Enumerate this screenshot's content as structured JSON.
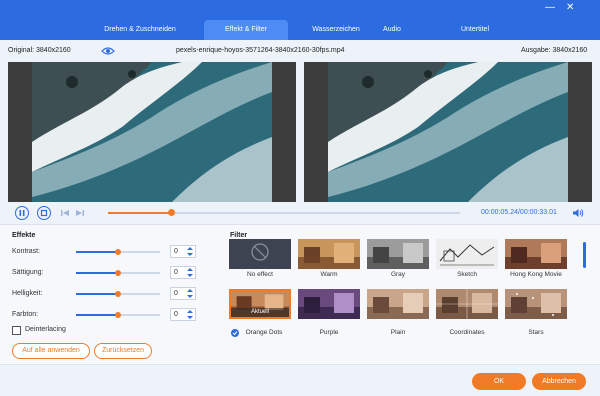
{
  "window": {
    "minimize_glyph": "—",
    "close_glyph": "✕"
  },
  "tabs": [
    {
      "label": "Drehen & Zuschneiden",
      "active": false
    },
    {
      "label": "Effekt & Filter",
      "active": true
    },
    {
      "label": "Wasserzeichen",
      "active": false
    },
    {
      "label": "Audio",
      "active": false
    },
    {
      "label": "Untertitel",
      "active": false
    }
  ],
  "infobar": {
    "original": "Original: 3840x2160",
    "filename": "pexels-enrique-hoyos-3571264-3840x2160-30fps.mp4",
    "output": "Ausgabe: 3840x2160"
  },
  "playback": {
    "progress": 0.18,
    "time": "00:00:05.24/00:00:33.01"
  },
  "effects": {
    "heading": "Effekte",
    "rows": [
      {
        "label": "Kontrast:",
        "value": "0",
        "level": 0.5
      },
      {
        "label": "Sättigung:",
        "value": "0",
        "level": 0.5
      },
      {
        "label": "Helligkeit:",
        "value": "0",
        "level": 0.5
      },
      {
        "label": "Farbton:",
        "value": "0",
        "level": 0.5
      }
    ],
    "deinterlacing": "Deinterlacing",
    "apply_all": "Auf alle anwenden",
    "reset": "Zurücksetzen"
  },
  "filters": {
    "heading": "Filter",
    "current_badge": "Aktuell",
    "items": [
      {
        "label": "No effect"
      },
      {
        "label": "Warm"
      },
      {
        "label": "Gray"
      },
      {
        "label": "Sketch"
      },
      {
        "label": "Hong Kong Movie"
      },
      {
        "label": "Orange Dots",
        "selected": true
      },
      {
        "label": "Purple"
      },
      {
        "label": "Plain"
      },
      {
        "label": "Coordinates"
      },
      {
        "label": "Stars"
      }
    ]
  },
  "footer": {
    "ok": "OK",
    "cancel": "Abbrechen"
  },
  "colors": {
    "brand_blue": "#2d6ce0",
    "accent_orange": "#f07a25"
  }
}
